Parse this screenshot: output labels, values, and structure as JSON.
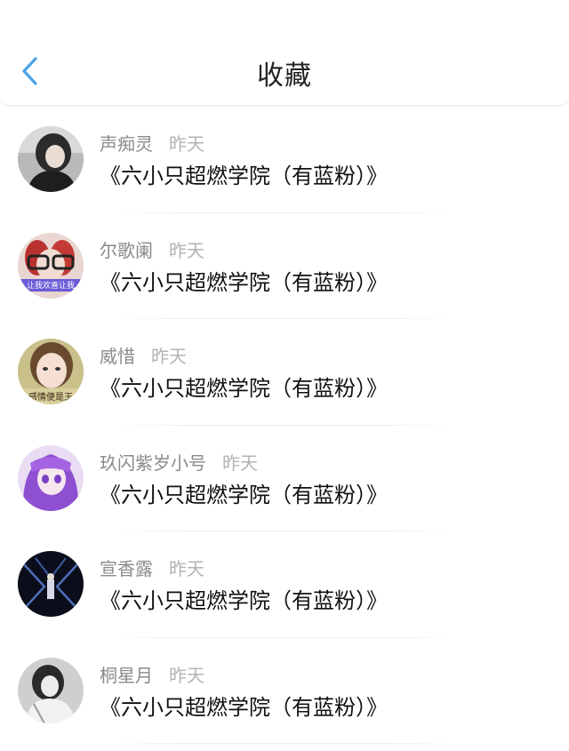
{
  "header": {
    "title": "收藏",
    "back_icon": "chevron-left-icon",
    "accent_color": "#4aa3e8"
  },
  "items": [
    {
      "name": "声痴灵",
      "time": "昨天",
      "title": "《六小只超燃学院（有蓝粉）》"
    },
    {
      "name": "尔歌阑",
      "time": "昨天",
      "title": "《六小只超燃学院（有蓝粉）》",
      "avatar_text": "让我欢喜让我"
    },
    {
      "name": "威惜",
      "time": "昨天",
      "title": "《六小只超燃学院（有蓝粉）》",
      "avatar_text": "感情便是王"
    },
    {
      "name": "玖闪紫岁小号",
      "time": "昨天",
      "title": "《六小只超燃学院（有蓝粉）》"
    },
    {
      "name": "宣香露",
      "time": "昨天",
      "title": "《六小只超燃学院（有蓝粉）》"
    },
    {
      "name": "桐星月",
      "time": "昨天",
      "title": "《六小只超燃学院（有蓝粉）》"
    }
  ]
}
